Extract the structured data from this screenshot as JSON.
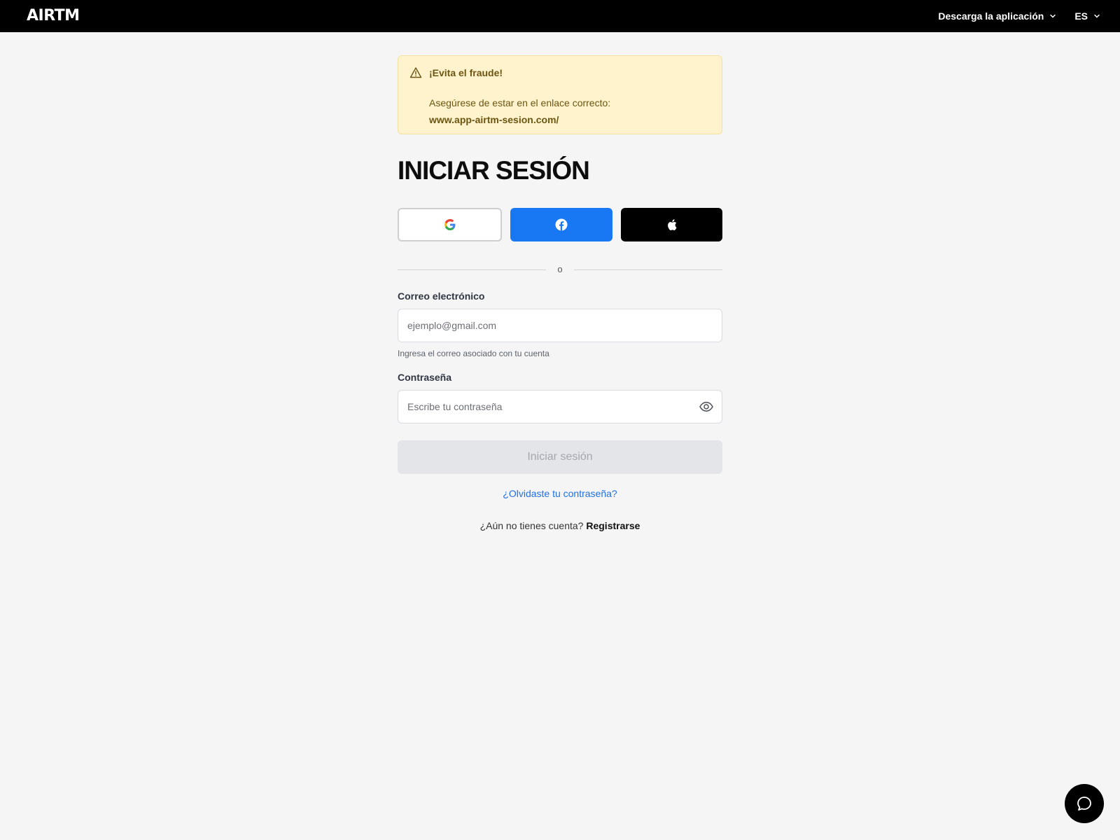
{
  "header": {
    "logo": "AIRTM",
    "download_label": "Descarga la aplicación",
    "language_label": "ES"
  },
  "alert": {
    "title": "¡Evita el fraude!",
    "text": "Asegúrese de estar en el enlace correcto:",
    "link": "www.app-airtm-sesion.com/"
  },
  "login": {
    "title": "INICIAR SESIÓN",
    "divider_text": "o",
    "email_label": "Correo electrónico",
    "email_placeholder": "ejemplo@gmail.com",
    "email_value": "",
    "email_helper": "Ingresa el correo asociado con tu cuenta",
    "password_label": "Contraseña",
    "password_placeholder": "Escribe tu contraseña",
    "password_value": "",
    "submit_label": "Iniciar sesión",
    "forgot_label": "¿Olvidaste tu contraseña?",
    "no_account_text": "¿Aún no tienes cuenta?",
    "signup_label": "Registrarse"
  },
  "social": {
    "google_icon": "google-icon",
    "facebook_icon": "facebook-icon",
    "apple_icon": "apple-icon"
  },
  "colors": {
    "topbar": "#000000",
    "alert_bg": "#fff3cd",
    "facebook": "#1877f2",
    "link": "#1f6fe5"
  }
}
